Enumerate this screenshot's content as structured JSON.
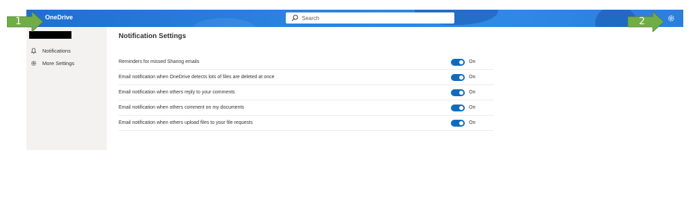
{
  "app": {
    "brand": "OneDrive"
  },
  "search": {
    "placeholder": "Search"
  },
  "sidebar": {
    "items": [
      {
        "label": "Notifications",
        "icon": "bell-icon"
      },
      {
        "label": "More Settings",
        "icon": "gear-icon"
      }
    ]
  },
  "main": {
    "title": "Notification Settings",
    "settings": [
      {
        "label": "Reminders for missed Sharing emails",
        "state": "On"
      },
      {
        "label": "Email notification when OneDrive detects lots of files are deleted at once",
        "state": "On"
      },
      {
        "label": "Email notification when others reply to your comments",
        "state": "On"
      },
      {
        "label": "Email notification when others comment on my documents",
        "state": "On"
      },
      {
        "label": "Email notification when others upload files to your file requests",
        "state": "On"
      }
    ]
  },
  "annotations": {
    "callout_1": "1",
    "callout_2": "2"
  },
  "colors": {
    "accent": "#0f6cbd",
    "topbar": "#2b82e0",
    "callout": "#70ad47"
  }
}
